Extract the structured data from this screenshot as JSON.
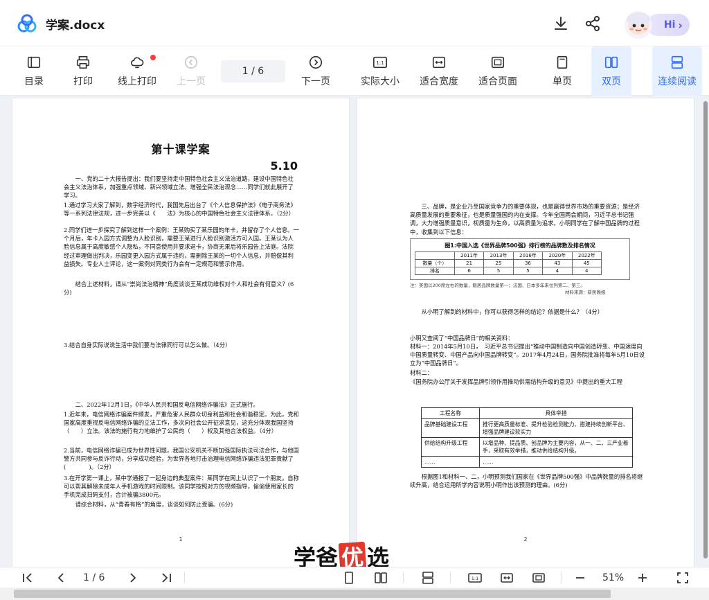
{
  "app": {
    "title": "学案.docx"
  },
  "header": {
    "hi_label": "Hi",
    "hi_chevron": "›"
  },
  "toolbar": {
    "items": [
      {
        "label": "目录",
        "icon": "toc-icon"
      },
      {
        "label": "打印",
        "icon": "printer-icon"
      },
      {
        "label": "线上打印",
        "icon": "cloud-print-icon"
      },
      {
        "label": "上一页",
        "icon": "prev-page-icon",
        "disabled": true
      },
      {
        "label": "下一页",
        "icon": "next-page-icon"
      },
      {
        "label": "实际大小",
        "icon": "actual-size-icon"
      },
      {
        "label": "适合宽度",
        "icon": "fit-width-icon"
      },
      {
        "label": "适合页面",
        "icon": "fit-page-icon"
      },
      {
        "label": "单页",
        "icon": "single-page-icon"
      },
      {
        "label": "双页",
        "icon": "double-page-icon",
        "active": true
      },
      {
        "label": "连续阅读",
        "icon": "continuous-read-icon",
        "active": true
      }
    ],
    "page_indicator": "1 / 6",
    "accent": "#2f6bff"
  },
  "page1": {
    "title": "第十课学案",
    "date": "5.10",
    "para1": "一、党的二十大报告提出：我们要坚持走中国特色社会主义法治道路，建设中国特色社会主义法治体系，加强重点领域、新兴领域立法。增强全民法治观念……同学们就此展开了学习。",
    "q1": "1.通过学习大家了解到，数字经济时代，我国先后出台了《个人信息保护法》《电子商务法》等一系列法律法规，进一步完善以《　　法》为核心的中国特色社会主义法律体系。（2分）",
    "q2": "2.同学们进一步探究了解到这样一个案例：王某购买了某乐园的年卡，并留存了个人信息。一个月后，年卡入园方式调整为人脸识别，需要王某进行人脸识别激活方可入园。王某认为人脸信息属于高度敏感个人隐私，不同意使用并要求退卡，协商无果后将乐园告上法庭。法院经过审理做出判决，乐园变更入园方式属于违约，需删除王某的一切个人信息，并赔偿其利益损失。专业人士评论，这一案例对同类行为会有一定规范和警示作用。",
    "q2b": "结合上述材料，请从“崇尚法治精神”角度谈谈王某成功维权对个人和社会有何意义？(6分)",
    "q3": "3.结合自身实际说说生活中我们要与法律同行可以怎么做。（4分）",
    "para2": "二、2022年12月1日，《中华人民共和国反电信网络诈骗法》正式施行。",
    "q4": "1.近年来，电信网络诈骗案件频发，严重危害人民群众切身利益和社会和谐稳定。为此，党和国家高度重视反电信网络诈骗的立法工作，多次向社会公开征求意见，这充分体现我国坚持（　　）立法。该法的施行有力地维护了公民的（　　）权及其他合法权益。（4分）",
    "q5": "2.当前，电信网络诈骗已成为世界性问题。我国公安机关不断加强国际执法司法合作，与他国警方共同参与反诈行动，分享成功经验，为世界各地打击治理电信网络诈骗违法犯罪贡献了(　　　　)。（2分）",
    "q6": "3.在开学第一课上，某中学通报了一起身边的典型案件：某同学在网上认识了一个朋友，自称可以帮其解除未成年人手机游戏的时间限制。该同学按照对方的视频指导，偷偷使用家长的手机完成扫码支付，合计被骗3800元。",
    "q6b": "请综合材料，从“青春有格”的角度，谈谈如何防止受骗。(6分)",
    "page_number": "1"
  },
  "page2": {
    "para3": "三、品牌，是企业乃至国家竞争力的重要体现，也是赢得世界市场的重要资源；是经济高质量发展的重要象征，也是质量强国的内在支撑。今年全国两会期间，习近平总书记强调，大力增强质量意识，视质量为生命，以高质量为追求。小明同学在了解中国品牌的过程中，收集到以下信息：",
    "q7": "从小明了解到的材料中，你可以获得怎样的结论？依据是什么？（4分）",
    "m_intro": "小明又查阅了“中国品牌日”的相关资料：",
    "m1": "材料一：2014年5月10日，　习近平总书记提出“推动中国制造向中国创造转变、中国速度向中国质量转变、中国产品向中国品牌转变”。2017年4月24日，国务院批准将每年5月10日设立为“中国品牌日”。",
    "m2_label": "材料二：",
    "m2": "《国务院办公厅关于发挥品牌引领作用推动供需结构升级的意见》中提出的重大工程",
    "q8": "根据图1和材料一、二，小明预测我们国家在《世界品牌500强》中品牌数量的排名将继续升高，结合运用所学内容说明小明作出该预测的理由。(6分)",
    "page_number": "2",
    "project_table": {
      "headers": [
        "工程名称",
        "具体举措"
      ],
      "rows": [
        [
          "品牌基础建设工程",
          "推行更高质量标准、提升检验检测能力、搭建持续创新平台、增强品牌建设软实力"
        ],
        [
          "供给结构升级工程",
          "以增品种、提品质、创品牌为主要内容，从一、二、三产业着手，采取有效举措，推动供给结构升级。"
        ],
        [
          "……",
          "……"
        ]
      ]
    }
  },
  "chart_data": {
    "type": "table",
    "title": "图1:中国入选《世界品牌500强》排行榜的品牌数及排名情况",
    "header_label": "",
    "categories": [
      "2011年",
      "2013年",
      "2016年",
      "2020年",
      "2022年"
    ],
    "series": [
      {
        "name": "数量（个）",
        "values": [
          21,
          25,
          36,
          43,
          45
        ]
      },
      {
        "name": "排名",
        "values": [
          6,
          5,
          5,
          4,
          4
        ]
      }
    ],
    "note": "注：美国以200席左右的数量，稳居品牌数量第一；法国、日本多年来位列第二、第三。",
    "source": "材料来源：新民晚报"
  },
  "bottombar": {
    "page_indicator": "1 / 6",
    "zoom": "51%"
  },
  "watermark": {
    "text_left": "学爸",
    "text_box": "优",
    "text_right": "选"
  }
}
